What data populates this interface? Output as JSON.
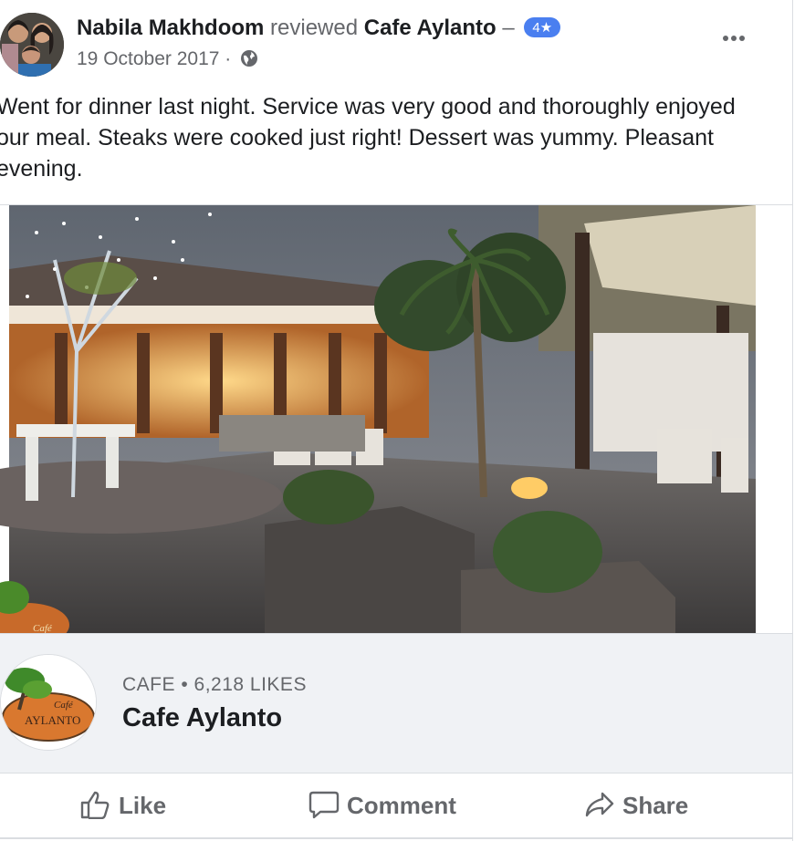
{
  "post": {
    "author": "Nabila Makhdoom",
    "action": "reviewed",
    "place": "Cafe Aylanto",
    "separator": "–",
    "rating": "4★",
    "date": "19 October 2017",
    "date_separator": "·",
    "privacy_icon": "globe-icon",
    "more_icon": "more-options-icon",
    "text": "Went for dinner last night. Service was very good and thoroughly enjoyed our meal. Steaks were cooked just right! Dessert was yummy. Pleasant evening."
  },
  "page": {
    "category": "CAFE • 6,218 LIKES",
    "name": "Cafe Aylanto",
    "logo_text_top": "Café",
    "logo_text_main": "AYLANTO"
  },
  "actions": {
    "like": {
      "label": "Like",
      "icon": "thumbs-up-icon"
    },
    "comment": {
      "label": "Comment",
      "icon": "comment-bubble-icon"
    },
    "share": {
      "label": "Share",
      "icon": "share-arrow-icon"
    }
  },
  "colors": {
    "rating_badge": "#4a7ff0",
    "secondary_text": "#65676b",
    "page_box_bg": "#f0f2f5"
  }
}
